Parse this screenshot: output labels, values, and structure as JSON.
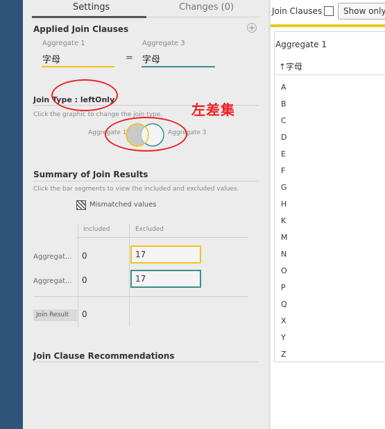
{
  "tabs": {
    "settings": "Settings",
    "changes": "Changes (0)"
  },
  "applied": {
    "title": "Applied Join Clauses",
    "left_label": "Aggregate 1",
    "left_field": "字母",
    "operator": "=",
    "right_label": "Aggregate 3",
    "right_field": "字母",
    "add_icon": "plus-circle-icon"
  },
  "join_type": {
    "title": "Join Type : leftOnly",
    "hint": "Click the graphic to change the join type.",
    "left_label": "Aggregate 1",
    "right_label": "Aggregate 3",
    "annotation": "左差集"
  },
  "summary": {
    "title": "Summary of Join Results",
    "hint": "Click the bar segments to view the included and excluded values.",
    "legend": "Mismatched values",
    "col_included": "Included",
    "col_excluded": "Excluded",
    "rows": [
      {
        "label": "Aggregat...",
        "included": "0",
        "excluded": "17",
        "color": "#f0c419"
      },
      {
        "label": "Aggregat...",
        "included": "0",
        "excluded": "17",
        "color": "#3a8f8a"
      }
    ],
    "join_result_label": "Join Result",
    "join_result_value": "0"
  },
  "recommendations": {
    "title": "Join Clause Recommendations"
  },
  "right_panel": {
    "title": "Join Clauses",
    "show_only": "Show only",
    "list_title": "Aggregate 1",
    "column_header": "↑字母",
    "values": [
      "A",
      "B",
      "C",
      "D",
      "E",
      "F",
      "G",
      "H",
      "K",
      "M",
      "N",
      "O",
      "P",
      "Q",
      "X",
      "Y",
      "Z"
    ]
  },
  "colors": {
    "sidebar": "#2f5479",
    "aggregate1": "#f0c419",
    "aggregate3": "#3a8f8a",
    "annotation": "#e22222"
  }
}
